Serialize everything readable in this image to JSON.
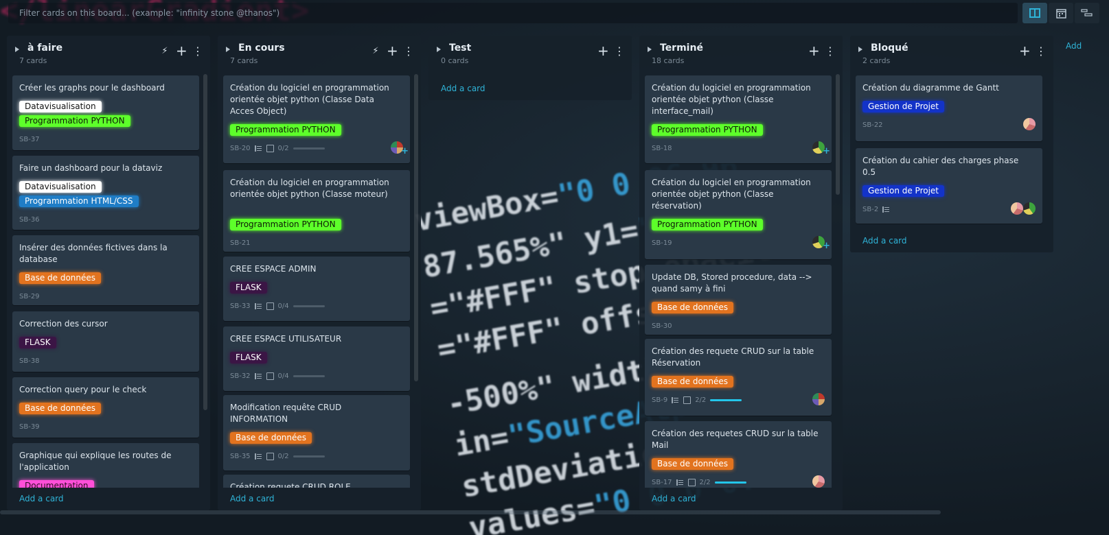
{
  "filter": {
    "placeholder": "Filter cards on this board... (example: \"infinity stone @thanos\")"
  },
  "view_buttons": [
    {
      "icon": "board-view-icon",
      "active": true
    },
    {
      "icon": "calendar-view-icon",
      "active": false
    },
    {
      "icon": "gantt-view-icon",
      "active": false
    }
  ],
  "label_colors": {
    "Datavisualisation": "#ffffff",
    "Programmation PYTHON": "#5dff2a",
    "Programmation HTML/CSS": "#1f7dc6",
    "Base de données": "#e2731f",
    "FLASK": "#3b1545",
    "Documentation": "#ff4fd8",
    "Gestion de Projet": "#1333c8"
  },
  "lists": [
    {
      "title": "à faire",
      "count": "7 cards",
      "add_label": "Add a card",
      "cards": [
        {
          "title": "Créer les graphs pour le dashboard",
          "labels": [
            "Datavisualisation",
            "Programmation PYTHON"
          ],
          "id": "SB-37"
        },
        {
          "title": "Faire un dashboard pour la dataviz",
          "labels": [
            "Datavisualisation",
            "Programmation HTML/CSS"
          ],
          "id": "SB-36"
        },
        {
          "title": "Insérer des données fictives dans la database",
          "labels": [
            "Base de données"
          ],
          "id": "SB-29"
        },
        {
          "title": "Correction des cursor",
          "labels": [
            "FLASK"
          ],
          "id": "SB-38"
        },
        {
          "title": "Correction query pour le check",
          "labels": [
            "Base de données"
          ],
          "id": "SB-39"
        },
        {
          "title": "Graphique qui explique les routes de l'application",
          "labels": [
            "Documentation"
          ],
          "id": ""
        }
      ]
    },
    {
      "title": "En cours",
      "count": "7 cards",
      "add_label": "Add a card",
      "cards": [
        {
          "title": "Création du logiciel en programmation orientée objet python (Classe Data Acces Object)",
          "labels": [
            "Programmation PYTHON"
          ],
          "id": "SB-20",
          "desc": true,
          "checklist": "0/2",
          "progress": 0,
          "avatar": "a1",
          "add_member": true
        },
        {
          "title": "Création du logiciel en programmation orientée objet python (Classe moteur)",
          "labels": [
            "Programmation PYTHON"
          ],
          "id": "SB-21"
        },
        {
          "title": "CREE ESPACE ADMIN",
          "labels": [
            "FLASK"
          ],
          "id": "SB-33",
          "desc": true,
          "checklist": "0/4",
          "progress": 0
        },
        {
          "title": "CREE ESPACE UTILISATEUR",
          "labels": [
            "FLASK"
          ],
          "id": "SB-32",
          "desc": true,
          "checklist": "0/4",
          "progress": 0
        },
        {
          "title": "Modification requête CRUD INFORMATION",
          "labels": [
            "Base de données"
          ],
          "id": "SB-35",
          "desc": true,
          "checklist": "0/2",
          "progress": 0
        },
        {
          "title": "Création requete CRUD ROLE",
          "labels": [],
          "id": ""
        }
      ]
    },
    {
      "title": "Test",
      "count": "0 cards",
      "add_label": "Add a card",
      "cards": []
    },
    {
      "title": "Terminé",
      "count": "18 cards",
      "add_label": "Add a card",
      "cards": [
        {
          "title": "Création du logiciel en programmation orientée objet python (Classe interface_mail)",
          "labels": [
            "Programmation PYTHON"
          ],
          "id": "SB-18",
          "avatar": "a3",
          "add_member": true
        },
        {
          "title": "Création du logiciel en programmation orientée objet python (Classe réservation)",
          "labels": [
            "Programmation PYTHON"
          ],
          "id": "SB-19",
          "avatar": "a3",
          "add_member": true
        },
        {
          "title": "Update DB, Stored procedure, data --> quand samy à fini",
          "labels": [
            "Base de données"
          ],
          "id": "SB-30"
        },
        {
          "title": "Création des requete CRUD sur la table Réservation",
          "labels": [
            "Base de données"
          ],
          "id": "SB-9",
          "desc": true,
          "checklist": "2/2",
          "progress": 1,
          "avatar": "a1"
        },
        {
          "title": "Création des requetes CRUD sur la table Mail",
          "labels": [
            "Base de données"
          ],
          "id": "SB-17",
          "desc": true,
          "checklist": "2/2",
          "progress": 1,
          "avatar": "a2"
        }
      ]
    },
    {
      "title": "Bloqué",
      "count": "2 cards",
      "add_label": "Add a card",
      "cards": [
        {
          "title": "Création du diagramme de Gantt",
          "labels": [
            "Gestion de Projet"
          ],
          "id": "SB-22",
          "avatar": "a2"
        },
        {
          "title": "Création du cahier des charges phase 0.5",
          "labels": [
            "Gestion de Projet"
          ],
          "id": "SB-2",
          "desc": true,
          "avatar": "a2",
          "avatar2": "a3"
        }
      ]
    }
  ],
  "edge_add": "Add"
}
